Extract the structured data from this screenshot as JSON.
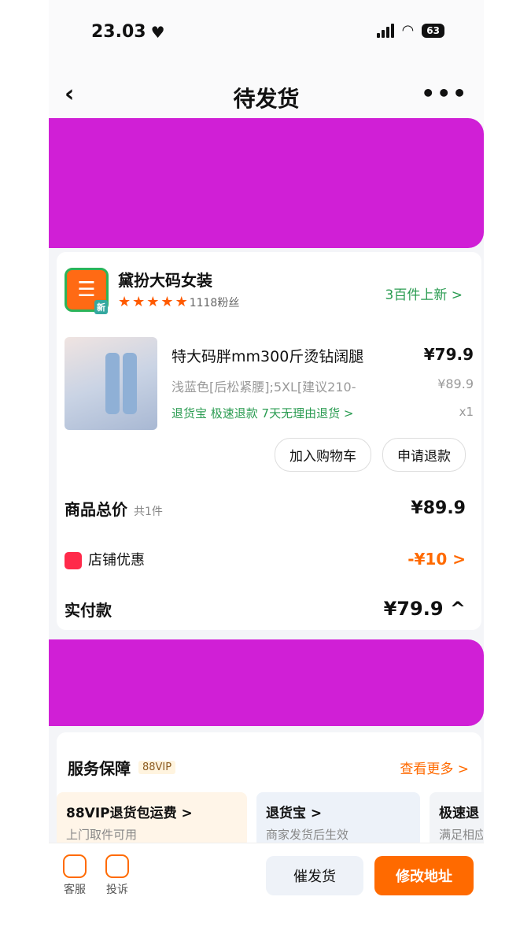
{
  "status_bar": {
    "time": "23.03",
    "battery": "63"
  },
  "nav": {
    "title": "待发货"
  },
  "shop": {
    "name": "黛扮大码女装",
    "fans": "1118粉丝",
    "new_link": "3百件上新 >",
    "new_badge": "新"
  },
  "product": {
    "title": "特大码胖mm300斤烫钻阔腿",
    "price": "¥79.9",
    "spec": "浅蓝色[后松紧腰];5XL[建议210-",
    "orig_price": "¥89.9",
    "tags": "退货宝  极速退款  7天无理由退货 >",
    "qty": "x1"
  },
  "actions": {
    "add_cart": "加入购物车",
    "refund": "申请退款"
  },
  "summary": {
    "total_label": "商品总价",
    "total_count": "共1件",
    "total_value": "¥89.9",
    "discount_label": "店铺优惠",
    "discount_value": "-¥10 >",
    "paid_label": "实付款",
    "paid_value": "¥79.9 ^"
  },
  "service": {
    "title": "服务保障",
    "vip_tag": "88VIP",
    "more": "查看更多 >",
    "boxes": [
      {
        "title": "88VIP退货包运费 >",
        "desc": "上门取件可用"
      },
      {
        "title": "退货宝 >",
        "desc": "商家发货后生效"
      },
      {
        "title": "极速退",
        "desc": "满足相应"
      }
    ]
  },
  "bottom": {
    "service_label": "客服",
    "complain_label": "投诉",
    "urge": "催发货",
    "change_addr": "修改地址"
  }
}
